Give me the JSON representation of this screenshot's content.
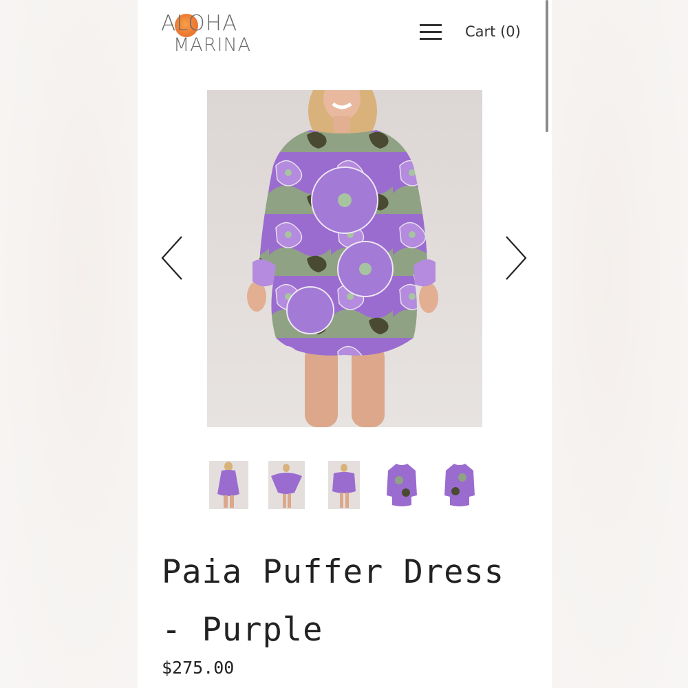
{
  "brand": {
    "logo_line1": "ALOHA",
    "logo_line2": "MARINA",
    "sun_color": "#ee7b33"
  },
  "header": {
    "menu_icon": "hamburger-menu-icon",
    "cart_label": "Cart (0)"
  },
  "gallery": {
    "prev_icon": "chevron-left-icon",
    "next_icon": "chevron-right-icon",
    "dress_color": "#9b6ccf",
    "thumbnail_count": 5
  },
  "product": {
    "title": "Paia Puffer Dress - Purple",
    "price": "$275.00"
  }
}
